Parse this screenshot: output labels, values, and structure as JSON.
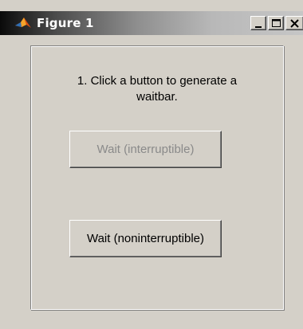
{
  "window": {
    "title": "Figure 1",
    "icon": "matlab-logo-icon",
    "controls": {
      "minimize": "minimize-icon",
      "maximize": "maximize-icon",
      "close": "close-icon"
    }
  },
  "panel": {
    "instructions_line1": "1. Click a button to generate a",
    "instructions_line2": "waitbar.",
    "buttons": {
      "interruptible": {
        "label": "Wait (interruptible)",
        "enabled": false
      },
      "noninterruptible": {
        "label": "Wait (noninterruptible)",
        "enabled": true
      }
    }
  },
  "colors": {
    "background": "#d4d0c8",
    "disabled_text": "#8a8a8a"
  }
}
